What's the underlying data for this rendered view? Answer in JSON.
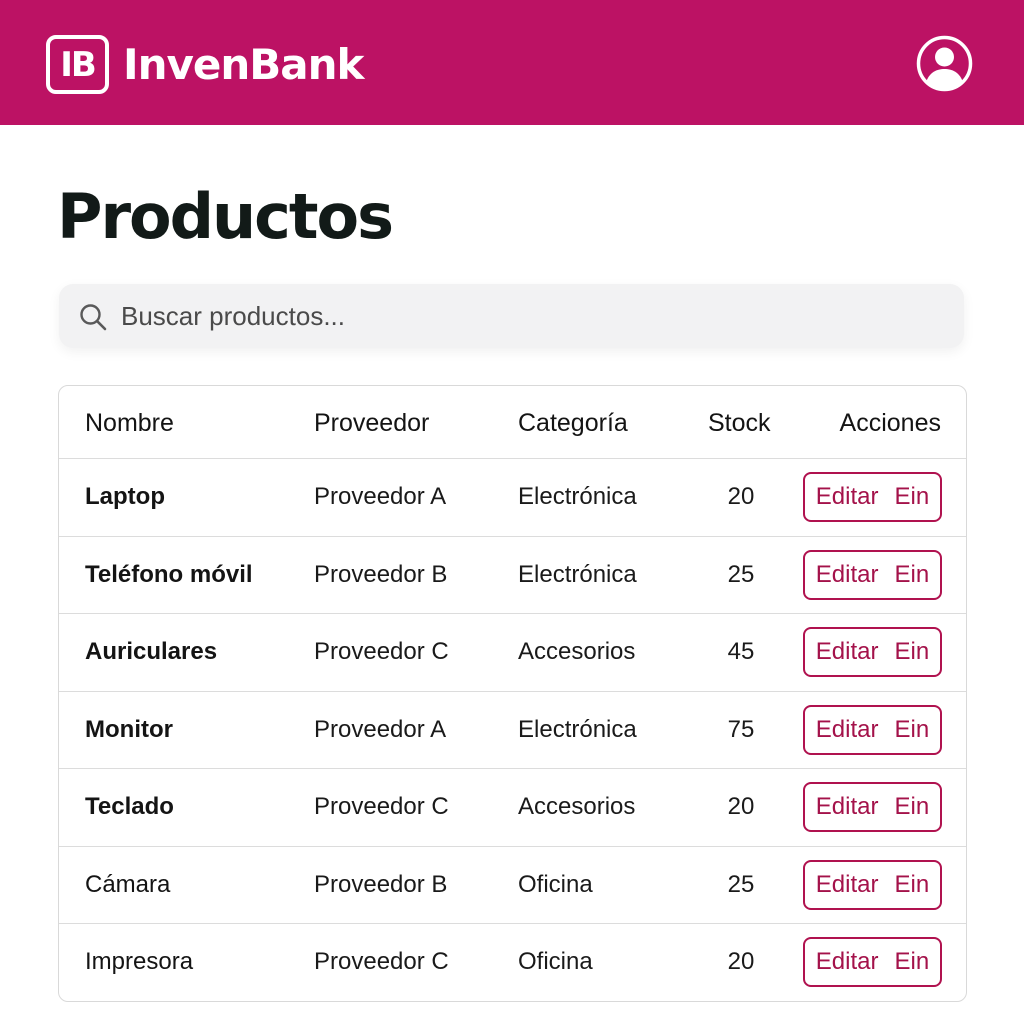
{
  "app": {
    "logo_text": "IB",
    "name": "InvenBank",
    "user_icon": "user-circle-icon"
  },
  "colors": {
    "brand": "#bc1264",
    "accent": "#a4124a"
  },
  "page": {
    "title": "Productos"
  },
  "search": {
    "placeholder": "Buscar productos...",
    "icon": "search-icon"
  },
  "table": {
    "headers": {
      "name": "Nombre",
      "supplier": "Proveedor",
      "category": "Categoría",
      "stock": "Stock",
      "actions": "Acciones"
    },
    "rows": [
      {
        "name": "Laptop",
        "supplier": "Proveedor A",
        "category": "Electrónica",
        "stock": "20",
        "edit": "Editar",
        "delete": "Ein"
      },
      {
        "name": "Teléfono móvil",
        "supplier": "Proveedor B",
        "category": "Electrónica",
        "stock": "25",
        "edit": "Editar",
        "delete": "Ein"
      },
      {
        "name": "Auriculares",
        "supplier": "Proveedor C",
        "category": "Accesorios",
        "stock": "45",
        "edit": "Editar",
        "delete": "Ein"
      },
      {
        "name": "Monitor",
        "supplier": "Proveedor A",
        "category": "Electrónica",
        "stock": "75",
        "edit": "Editar",
        "delete": "Ein"
      },
      {
        "name": "Teclado",
        "supplier": "Proveedor C",
        "category": "Accesorios",
        "stock": "20",
        "edit": "Editar",
        "delete": "Ein"
      },
      {
        "name": "Cámara",
        "supplier": "Proveedor B",
        "category": "Oficina",
        "stock": "25",
        "edit": "Editar",
        "delete": "Ein"
      },
      {
        "name": "Impresora",
        "supplier": "Proveedor C",
        "category": "Oficina",
        "stock": "20",
        "edit": "Editar",
        "delete": "Ein"
      }
    ]
  }
}
